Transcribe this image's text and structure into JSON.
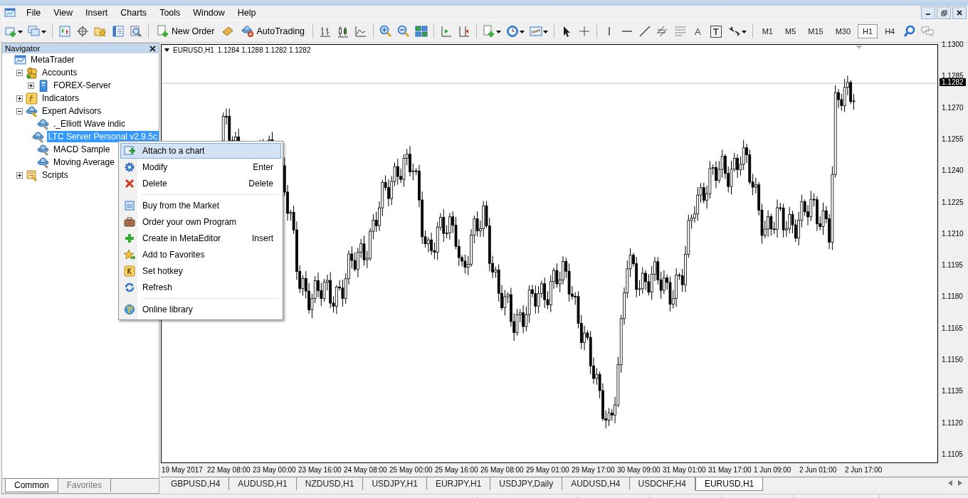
{
  "menu": [
    "File",
    "View",
    "Insert",
    "Charts",
    "Tools",
    "Window",
    "Help"
  ],
  "toolbar": {
    "new_order": "New Order",
    "autotrading": "AutoTrading",
    "text_tool": "A",
    "label_tool": "T",
    "timeframes": [
      {
        "label": "M1",
        "selected": false
      },
      {
        "label": "M5",
        "selected": false
      },
      {
        "label": "M15",
        "selected": false
      },
      {
        "label": "M30",
        "selected": false
      },
      {
        "label": "H1",
        "selected": true
      },
      {
        "label": "H4",
        "selected": false
      }
    ]
  },
  "navigator": {
    "title": "Navigator",
    "tree": [
      {
        "kind": "root",
        "label": "MetaTrader",
        "selected": false,
        "children": [
          {
            "kind": "accounts",
            "label": "Accounts",
            "expanded": true,
            "selected": false,
            "children": [
              {
                "kind": "server",
                "label": "FOREX-Server",
                "expanded": false,
                "selected": false
              }
            ]
          },
          {
            "kind": "indicators",
            "label": "Indicators",
            "expanded": false,
            "selected": false
          },
          {
            "kind": "experts",
            "label": "Expert Advisors",
            "expanded": true,
            "selected": false,
            "children": [
              {
                "kind": "expert",
                "label": "._Elliott Wave indic",
                "selected": false
              },
              {
                "kind": "expert",
                "label": "LTC Server Personal v2.9.5c",
                "selected": true
              },
              {
                "kind": "expert",
                "label": "MACD Sample",
                "selected": false
              },
              {
                "kind": "expert",
                "label": "Moving Average",
                "selected": false
              }
            ]
          },
          {
            "kind": "scripts",
            "label": "Scripts",
            "expanded": false,
            "selected": false
          }
        ]
      }
    ],
    "tabs": [
      {
        "label": "Common",
        "selected": true
      },
      {
        "label": "Favorites",
        "selected": false
      }
    ]
  },
  "context_menu": [
    {
      "kind": "attach",
      "label": "Attach to a chart",
      "selected": true
    },
    {
      "kind": "modify",
      "label": "Modify",
      "shortcut": "Enter",
      "selected": false
    },
    {
      "kind": "delete",
      "label": "Delete",
      "shortcut": "Delete",
      "selected": false
    },
    {
      "kind": "separator"
    },
    {
      "kind": "market",
      "label": "Buy from the Market",
      "selected": false
    },
    {
      "kind": "order",
      "label": "Order your own Program",
      "selected": false
    },
    {
      "kind": "create",
      "label": "Create in MetaEditor",
      "shortcut": "Insert",
      "selected": false
    },
    {
      "kind": "favorites",
      "label": "Add to Favorites",
      "selected": false
    },
    {
      "kind": "hotkey",
      "label": "Set hotkey",
      "selected": false
    },
    {
      "kind": "refresh",
      "label": "Refresh",
      "selected": false
    },
    {
      "kind": "separator"
    },
    {
      "kind": "library",
      "label": "Online library",
      "selected": false
    }
  ],
  "chart": {
    "symbol": "EURUSD,H1",
    "ohlc": "1.1284 1.1288 1.1282 1.1282",
    "current_price": "1.1282",
    "price_labels": [
      "1.1300",
      "1.1285",
      "1.1270",
      "1.1255",
      "1.1240",
      "1.1225",
      "1.1210",
      "1.1195",
      "1.1180",
      "1.1165",
      "1.1150",
      "1.1135",
      "1.1120",
      "1.1105"
    ],
    "time_labels": [
      "19 May 2017",
      "22 May 08:00",
      "23 May 00:00",
      "23 May 16:00",
      "24 May 08:00",
      "25 May 00:00",
      "25 May 16:00",
      "26 May 08:00",
      "29 May 01:00",
      "29 May 17:00",
      "30 May 09:00",
      "31 May 01:00",
      "31 May 17:00",
      "1 Jun 09:00",
      "2 Jun 01:00",
      "2 Jun 17:00"
    ]
  },
  "chart_tabs": [
    {
      "label": "GBPUSD,H4",
      "selected": false
    },
    {
      "label": "AUDUSD,H1",
      "selected": false
    },
    {
      "label": "NZDUSD,H1",
      "selected": false
    },
    {
      "label": "USDJPY,H1",
      "selected": false
    },
    {
      "label": "EURJPY,H1",
      "selected": false
    },
    {
      "label": "USDJPY,Daily",
      "selected": false
    },
    {
      "label": "AUDUSD,H4",
      "selected": false
    },
    {
      "label": "USDCHF,H4",
      "selected": false
    },
    {
      "label": "EURUSD,H1",
      "selected": true
    }
  ]
}
